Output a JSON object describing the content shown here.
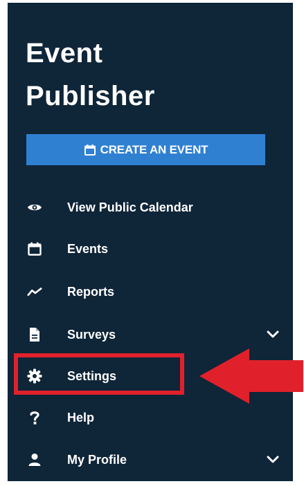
{
  "brand": {
    "line1": "Event",
    "line2": "Publisher"
  },
  "create_button": {
    "label": "CREATE AN EVENT",
    "icon": "calendar-icon",
    "color": "#2f80d1"
  },
  "nav": {
    "items": [
      {
        "label": "View Public Calendar",
        "icon": "eye-icon",
        "has_chevron": false
      },
      {
        "label": "Events",
        "icon": "calendar-icon",
        "has_chevron": false
      },
      {
        "label": "Reports",
        "icon": "trend-line-icon",
        "has_chevron": false
      },
      {
        "label": "Surveys",
        "icon": "document-icon",
        "has_chevron": true
      },
      {
        "label": "Settings",
        "icon": "gear-icon",
        "has_chevron": false,
        "highlighted": true
      },
      {
        "label": "Help",
        "icon": "question-mark-icon",
        "has_chevron": false
      },
      {
        "label": "My Profile",
        "icon": "person-icon",
        "has_chevron": true
      }
    ]
  },
  "annotation": {
    "highlight_color": "#e0212b",
    "arrow_icon": "arrow-left-icon"
  },
  "colors": {
    "sidebar_bg": "#0f2538",
    "text": "#ffffff"
  }
}
